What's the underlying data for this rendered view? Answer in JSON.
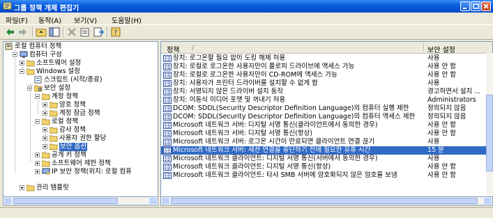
{
  "window": {
    "title": "그룹 정책 개체 편집기"
  },
  "menu": [
    "파일(F)",
    "동작(A)",
    "보기(V)",
    "도움말(H)"
  ],
  "tree": [
    {
      "label": "로컬 컴퓨터 정책",
      "icon": "policy-icon"
    },
    {
      "label": "컴퓨터 구성",
      "icon": "computer-icon"
    },
    {
      "label": "소프트웨어 설정",
      "icon": "folder-icon"
    },
    {
      "label": "Windows 설정",
      "icon": "folder-icon"
    },
    {
      "label": "스크립트 (시작/종료)",
      "icon": "script-icon"
    },
    {
      "label": "보안 설정",
      "icon": "security-icon"
    },
    {
      "label": "계정 정책",
      "icon": "folder-icon"
    },
    {
      "label": "암호 정책",
      "icon": "folder-icon"
    },
    {
      "label": "계정 잠금 정책",
      "icon": "folder-icon"
    },
    {
      "label": "로컬 정책",
      "icon": "folder-icon"
    },
    {
      "label": "감사 정책",
      "icon": "folder-icon"
    },
    {
      "label": "사용자 권한 할당",
      "icon": "folder-icon"
    },
    {
      "label": "보안 옵션",
      "icon": "folder-icon"
    },
    {
      "label": "공개 키 정책",
      "icon": "folder-icon"
    },
    {
      "label": "소프트웨어 제한 정책",
      "icon": "folder-icon"
    },
    {
      "label": "IP 보안 정책(위치: 로컬 컴퓨",
      "icon": "ip-security-icon"
    },
    {
      "label": "관리 템플릿",
      "icon": "folder-icon"
    }
  ],
  "list_header": {
    "policy": "정책",
    "setting": "보안 설정"
  },
  "policies": [
    {
      "name": "장치: 로그온할 필요 없이 도킹 해제 허용",
      "value": "사용"
    },
    {
      "name": "장치: 로컬로 로그온한 사용자만이 플로피 드라이브에 액세스 가능",
      "value": "사용 안 함"
    },
    {
      "name": "장치: 로컬로 로그온한 사용자만이 CD-ROM에 액세스 가능",
      "value": "사용 안 함"
    },
    {
      "name": "장치: 사용자가 프린터 드라이버를 설치할 수 없게 함",
      "value": "사용"
    },
    {
      "name": "장치: 서명되지 않은 드라이버 설치 동작",
      "value": "경고하면서 설치 ..."
    },
    {
      "name": "장치: 이동식 미디어 포맷 및 꺼내기 허용",
      "value": "Administrators"
    },
    {
      "name": "DCOM: SDDL(Security Descriptor Definition Language)의 컴퓨터 실행 제한",
      "value": "정의되지 않음"
    },
    {
      "name": "DCOM: SDDL(Security Descriptor Definition Language)의 컴퓨터 액세스 제한",
      "value": "정의되지 않음"
    },
    {
      "name": "Microsoft 네트워크 서버: 디지털 서명 통신(클라이언트에서 동의한 경우)",
      "value": "사용 안 함"
    },
    {
      "name": "Microsoft 네트워크 서버: 디지털 서명 통신(항상)",
      "value": "사용 안 함"
    },
    {
      "name": "Microsoft 네트워크 서버: 로그온 시간이 만료되면 클라이언트 연결 끊기",
      "value": "사용"
    },
    {
      "name": "Microsoft 네트워크 서버: 세션 연결을 중단하기 전에 필요한 유휴 시간",
      "value": "15 분"
    },
    {
      "name": "Microsoft 네트워크 클라이언트: 디지털 서명 통신(서버에서 동의한 경우)",
      "value": "사용"
    },
    {
      "name": "Microsoft 네트워크 클라이언트: 디지털 서명 통신(항상)",
      "value": "사용 안 함"
    },
    {
      "name": "Microsoft 네트워크 클라이언트: 타사 SMB 서버에 암호화되지 않은 암호를 보냄",
      "value": "사용 안 함"
    }
  ],
  "selected_policy_index": 11
}
